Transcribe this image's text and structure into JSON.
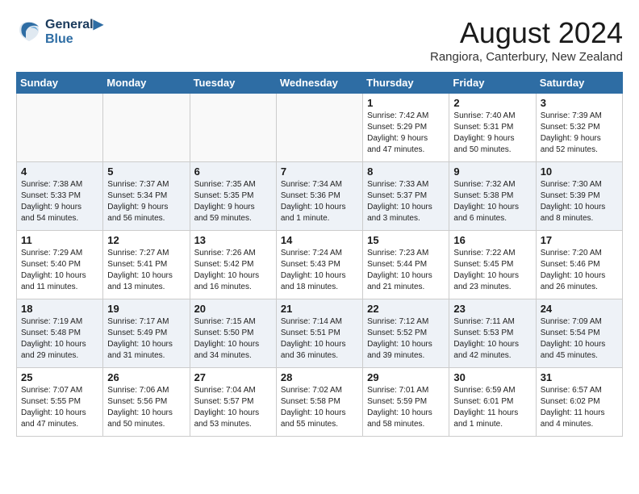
{
  "header": {
    "logo_line1": "General",
    "logo_line2": "Blue",
    "month": "August 2024",
    "location": "Rangiora, Canterbury, New Zealand"
  },
  "days_of_week": [
    "Sunday",
    "Monday",
    "Tuesday",
    "Wednesday",
    "Thursday",
    "Friday",
    "Saturday"
  ],
  "weeks": [
    [
      {
        "day": "",
        "info": ""
      },
      {
        "day": "",
        "info": ""
      },
      {
        "day": "",
        "info": ""
      },
      {
        "day": "",
        "info": ""
      },
      {
        "day": "1",
        "info": "Sunrise: 7:42 AM\nSunset: 5:29 PM\nDaylight: 9 hours\nand 47 minutes."
      },
      {
        "day": "2",
        "info": "Sunrise: 7:40 AM\nSunset: 5:31 PM\nDaylight: 9 hours\nand 50 minutes."
      },
      {
        "day": "3",
        "info": "Sunrise: 7:39 AM\nSunset: 5:32 PM\nDaylight: 9 hours\nand 52 minutes."
      }
    ],
    [
      {
        "day": "4",
        "info": "Sunrise: 7:38 AM\nSunset: 5:33 PM\nDaylight: 9 hours\nand 54 minutes."
      },
      {
        "day": "5",
        "info": "Sunrise: 7:37 AM\nSunset: 5:34 PM\nDaylight: 9 hours\nand 56 minutes."
      },
      {
        "day": "6",
        "info": "Sunrise: 7:35 AM\nSunset: 5:35 PM\nDaylight: 9 hours\nand 59 minutes."
      },
      {
        "day": "7",
        "info": "Sunrise: 7:34 AM\nSunset: 5:36 PM\nDaylight: 10 hours\nand 1 minute."
      },
      {
        "day": "8",
        "info": "Sunrise: 7:33 AM\nSunset: 5:37 PM\nDaylight: 10 hours\nand 3 minutes."
      },
      {
        "day": "9",
        "info": "Sunrise: 7:32 AM\nSunset: 5:38 PM\nDaylight: 10 hours\nand 6 minutes."
      },
      {
        "day": "10",
        "info": "Sunrise: 7:30 AM\nSunset: 5:39 PM\nDaylight: 10 hours\nand 8 minutes."
      }
    ],
    [
      {
        "day": "11",
        "info": "Sunrise: 7:29 AM\nSunset: 5:40 PM\nDaylight: 10 hours\nand 11 minutes."
      },
      {
        "day": "12",
        "info": "Sunrise: 7:27 AM\nSunset: 5:41 PM\nDaylight: 10 hours\nand 13 minutes."
      },
      {
        "day": "13",
        "info": "Sunrise: 7:26 AM\nSunset: 5:42 PM\nDaylight: 10 hours\nand 16 minutes."
      },
      {
        "day": "14",
        "info": "Sunrise: 7:24 AM\nSunset: 5:43 PM\nDaylight: 10 hours\nand 18 minutes."
      },
      {
        "day": "15",
        "info": "Sunrise: 7:23 AM\nSunset: 5:44 PM\nDaylight: 10 hours\nand 21 minutes."
      },
      {
        "day": "16",
        "info": "Sunrise: 7:22 AM\nSunset: 5:45 PM\nDaylight: 10 hours\nand 23 minutes."
      },
      {
        "day": "17",
        "info": "Sunrise: 7:20 AM\nSunset: 5:46 PM\nDaylight: 10 hours\nand 26 minutes."
      }
    ],
    [
      {
        "day": "18",
        "info": "Sunrise: 7:19 AM\nSunset: 5:48 PM\nDaylight: 10 hours\nand 29 minutes."
      },
      {
        "day": "19",
        "info": "Sunrise: 7:17 AM\nSunset: 5:49 PM\nDaylight: 10 hours\nand 31 minutes."
      },
      {
        "day": "20",
        "info": "Sunrise: 7:15 AM\nSunset: 5:50 PM\nDaylight: 10 hours\nand 34 minutes."
      },
      {
        "day": "21",
        "info": "Sunrise: 7:14 AM\nSunset: 5:51 PM\nDaylight: 10 hours\nand 36 minutes."
      },
      {
        "day": "22",
        "info": "Sunrise: 7:12 AM\nSunset: 5:52 PM\nDaylight: 10 hours\nand 39 minutes."
      },
      {
        "day": "23",
        "info": "Sunrise: 7:11 AM\nSunset: 5:53 PM\nDaylight: 10 hours\nand 42 minutes."
      },
      {
        "day": "24",
        "info": "Sunrise: 7:09 AM\nSunset: 5:54 PM\nDaylight: 10 hours\nand 45 minutes."
      }
    ],
    [
      {
        "day": "25",
        "info": "Sunrise: 7:07 AM\nSunset: 5:55 PM\nDaylight: 10 hours\nand 47 minutes."
      },
      {
        "day": "26",
        "info": "Sunrise: 7:06 AM\nSunset: 5:56 PM\nDaylight: 10 hours\nand 50 minutes."
      },
      {
        "day": "27",
        "info": "Sunrise: 7:04 AM\nSunset: 5:57 PM\nDaylight: 10 hours\nand 53 minutes."
      },
      {
        "day": "28",
        "info": "Sunrise: 7:02 AM\nSunset: 5:58 PM\nDaylight: 10 hours\nand 55 minutes."
      },
      {
        "day": "29",
        "info": "Sunrise: 7:01 AM\nSunset: 5:59 PM\nDaylight: 10 hours\nand 58 minutes."
      },
      {
        "day": "30",
        "info": "Sunrise: 6:59 AM\nSunset: 6:01 PM\nDaylight: 11 hours\nand 1 minute."
      },
      {
        "day": "31",
        "info": "Sunrise: 6:57 AM\nSunset: 6:02 PM\nDaylight: 11 hours\nand 4 minutes."
      }
    ]
  ]
}
